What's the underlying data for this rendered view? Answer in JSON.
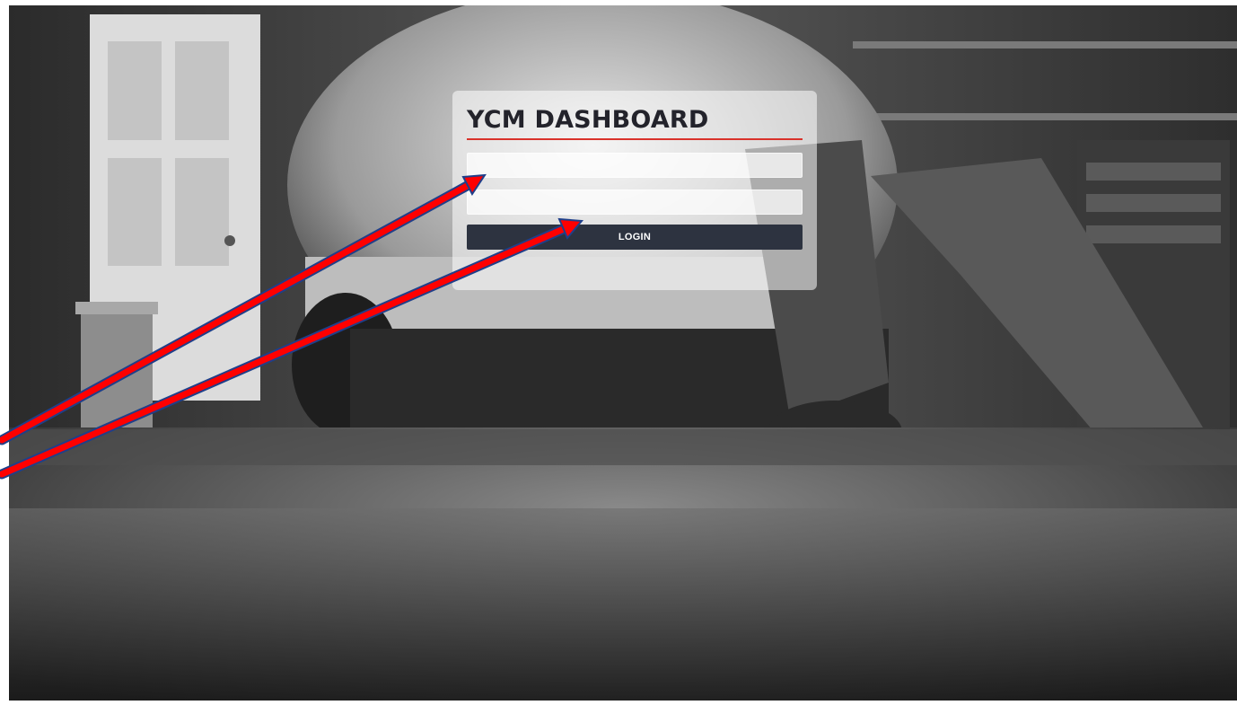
{
  "login": {
    "title": "YCM DASHBOARD",
    "username_value": "",
    "password_value": "",
    "button_label": "LOGIN"
  },
  "colors": {
    "accent_underline": "#d9322b",
    "button_background": "#2d3340",
    "annotation_arrow": "#ff0000"
  },
  "background": {
    "description_icon": "garage-photo"
  }
}
